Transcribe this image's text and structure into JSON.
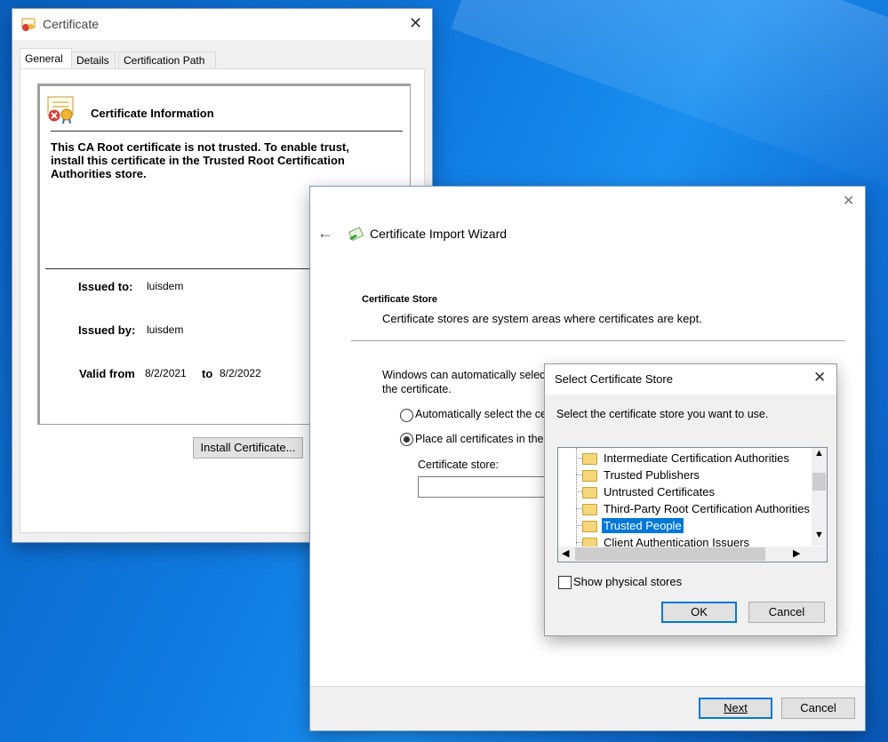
{
  "cert_window": {
    "title": "Certificate",
    "tabs": [
      "General",
      "Details",
      "Certification Path"
    ],
    "info_heading": "Certificate Information",
    "warning": "This CA Root certificate is not trusted. To enable trust, install this certificate in the Trusted Root Certification Authorities store.",
    "issued_to_label": "Issued to:",
    "issued_to_value": "luisdem",
    "issued_by_label": "Issued by:",
    "issued_by_value": "luisdem",
    "valid_from_label": "Valid from",
    "valid_from_value": "8/2/2021",
    "valid_to_label": "to",
    "valid_to_value": "8/2/2022",
    "install_button": "Install Certificate..."
  },
  "wizard": {
    "title": "Certificate Import Wizard",
    "section_title": "Certificate Store",
    "section_desc": "Certificate stores are system areas where certificates are kept.",
    "intro_line1": "Windows can automatically selec",
    "intro_line2": "the certificate.",
    "radio_auto_label": "Automatically select the ce",
    "radio_place_label": "Place all certificates in the",
    "store_label": "Certificate store:",
    "store_value": "",
    "next_button": "Next",
    "cancel_button": "Cancel"
  },
  "store_dialog": {
    "title": "Select Certificate Store",
    "prompt": "Select the certificate store you want to use.",
    "items": [
      "Intermediate Certification Authorities",
      "Trusted Publishers",
      "Untrusted Certificates",
      "Third-Party Root Certification Authorities",
      "Trusted People",
      "Client Authentication Issuers"
    ],
    "selected_item": "Trusted People",
    "show_physical_label": "Show physical stores",
    "ok_button": "OK",
    "cancel_button": "Cancel"
  },
  "colors": {
    "accent": "#0078d7",
    "selection": "#0078d7"
  }
}
